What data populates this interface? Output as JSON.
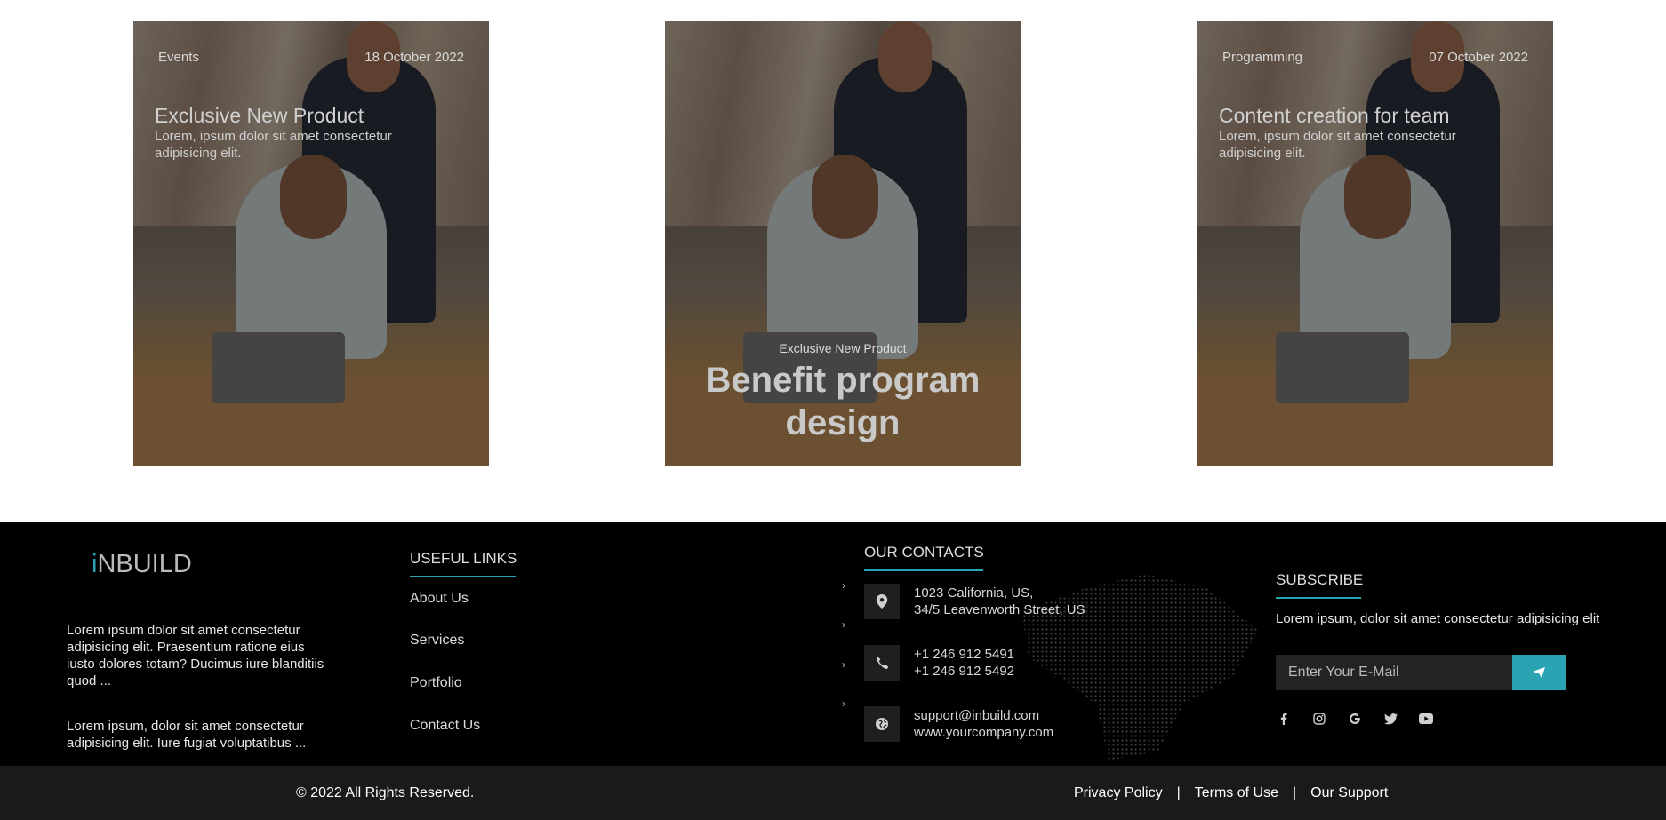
{
  "cards": [
    {
      "category": "Events",
      "date": "18 October 2022",
      "title": "Exclusive New Product",
      "desc": "Lorem, ipsum dolor sit amet consectetur adipisicing elit."
    },
    {
      "caption": "Exclusive New Product",
      "title": "Benefit program design"
    },
    {
      "category": "Programming",
      "date": "07 October 2022",
      "title": "Content creation for team",
      "desc": "Lorem, ipsum dolor sit amet consectetur adipisicing elit."
    }
  ],
  "footer": {
    "logo_i": "i",
    "logo_rest": "NBUILD",
    "about": [
      "Lorem ipsum dolor sit amet consectetur adipisicing elit. Praesentium ratione eius iusto dolores totam? Ducimus iure blanditiis quod ...",
      "Lorem ipsum, dolor sit amet consectetur adipisicing elit. Iure fugiat voluptatibus ..."
    ],
    "useful_links": {
      "heading": "USEFUL LINKS",
      "items": [
        "About Us",
        "Services",
        "Portfolio",
        "Contact Us"
      ]
    },
    "contacts": {
      "heading": "OUR CONTACTS",
      "address": [
        "1023 California, US,",
        "34/5 Leavenworth Street, US"
      ],
      "phones": [
        "+1 246 912 5491",
        "+1 246 912 5492"
      ],
      "web": [
        "support@inbuild.com",
        "www.yourcompany.com"
      ],
      "icons": [
        "location-pin-icon",
        "phone-icon",
        "globe-icon"
      ]
    },
    "subscribe": {
      "heading": "SUBSCRIBE",
      "text": "Lorem ipsum, dolor sit amet consectetur adipisicing elit",
      "placeholder": "Enter Your E-Mail",
      "social": [
        "facebook-icon",
        "instagram-icon",
        "google-icon",
        "twitter-icon",
        "youtube-icon"
      ]
    }
  },
  "bottom": {
    "copyright": "© 2022 All Rights Reserved.",
    "links": [
      "Privacy Policy",
      "Terms of Use",
      "Our Support"
    ],
    "separator": "|"
  },
  "colors": {
    "accent": "#2aa3b3",
    "footer_bg": "#000000",
    "bottom_bar_bg": "#1a1a1a"
  }
}
